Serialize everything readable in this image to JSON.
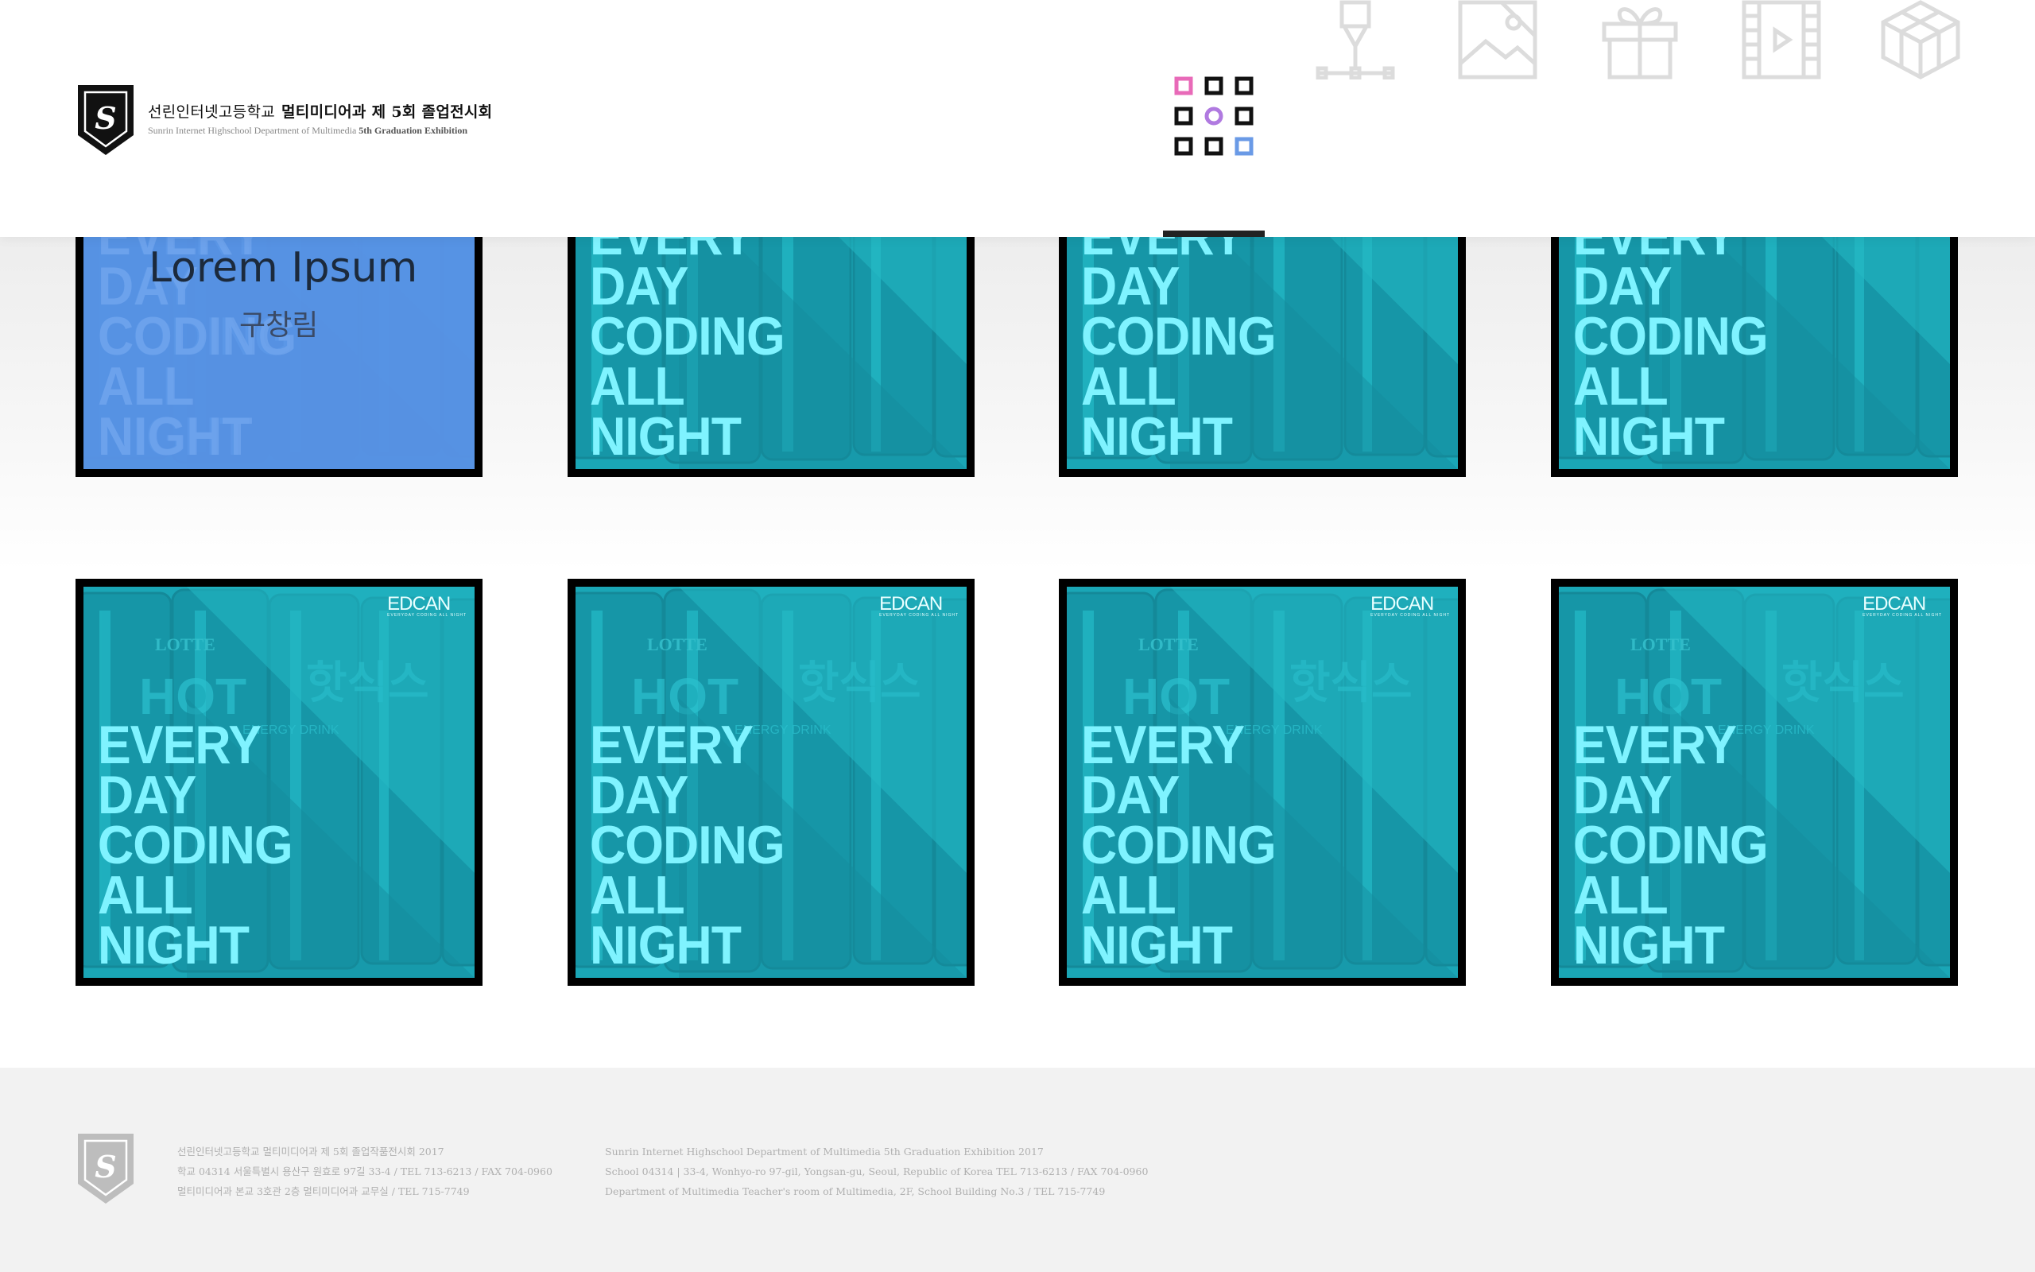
{
  "header": {
    "school_name": "선린인터넷고등학교",
    "exhibition_title": "멀티미디어과 제 5회 졸업전시회",
    "subtitle_plain": "Sunrin Internet Highschool Department of Multimedia",
    "subtitle_bold": "5th Graduation Exhibition"
  },
  "nav": {
    "items": [
      {
        "icon": "grid-icon",
        "active": true
      },
      {
        "icon": "pen-tool-icon",
        "active": false
      },
      {
        "icon": "image-icon",
        "active": false
      },
      {
        "icon": "gift-icon",
        "active": false
      },
      {
        "icon": "film-icon",
        "active": false
      },
      {
        "icon": "cube-icon",
        "active": false
      }
    ]
  },
  "gallery": {
    "hover_card": {
      "title": "Lorem Ipsum",
      "author": "구창림"
    },
    "poster_lines": [
      "EVERY",
      "DAY",
      "CODING",
      "ALL",
      "NIGHT"
    ],
    "brand_mark": "EDCAN",
    "brand_mark_small": "EVERYDAY CODING ALL NIGHT",
    "can_text": [
      "LOTTE",
      "HOT",
      "핫식스",
      "ENERGY DRINK"
    ]
  },
  "footer": {
    "col1": [
      "선린인터넷고등학교 멀티미디어과 제 5회 졸업작품전시회 2017",
      "학교 04314 서울특별시 용산구 원효로 97길 33-4 / TEL 713-6213 / FAX 704-0960",
      "멀티미디어과 본교 3호관 2층 멀티미디어과 교무실 / TEL 715-7749"
    ],
    "col2": [
      "Sunrin Internet Highschool Department of Multimedia 5th Graduation Exhibition 2017",
      "School 04314 | 33-4, Wonhyo-ro 97-gil, Yongsan-gu, Seoul, Republic of Korea TEL 713-6213 / FAX 704-0960",
      "Department of Multimedia Teacher's room of Multimedia, 2F, School Building No.3 / TEL 715-7749"
    ]
  },
  "colors": {
    "accent_pink": "#e86ab8",
    "accent_purple": "#b07ae0",
    "accent_blue": "#6a9ae6",
    "poster_cyan": "#1aa5b5",
    "poster_text": "#7ff3ff",
    "hover_blue": "#5a91e6"
  }
}
